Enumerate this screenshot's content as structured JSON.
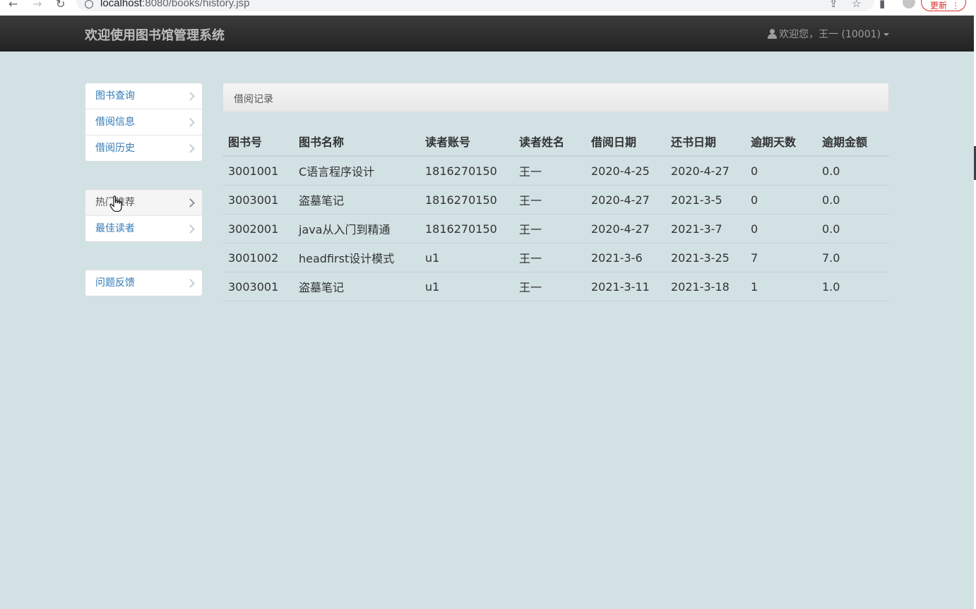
{
  "browser": {
    "url_host": "localhost",
    "url_rest": ":8080/books/history.jsp",
    "update_label": "更新",
    "update_more": "⋮"
  },
  "navbar": {
    "brand": "欢迎使用图书馆管理系统",
    "user_label": "欢迎您，王一 (10001)"
  },
  "sidebar": {
    "groups": [
      {
        "items": [
          {
            "label": "图书查询"
          },
          {
            "label": "借阅信息"
          },
          {
            "label": "借阅历史"
          }
        ]
      },
      {
        "items": [
          {
            "label": "热门推荐"
          },
          {
            "label": "最佳读者"
          }
        ]
      },
      {
        "items": [
          {
            "label": "问题反馈"
          }
        ]
      }
    ]
  },
  "content": {
    "heading": "借阅记录",
    "columns": [
      "图书号",
      "图书名称",
      "读者账号",
      "读者姓名",
      "借阅日期",
      "还书日期",
      "逾期天数",
      "逾期金额"
    ],
    "rows": [
      [
        "3001001",
        "C语言程序设计",
        "1816270150",
        "王一",
        "2020-4-25",
        "2020-4-27",
        "0",
        "0.0"
      ],
      [
        "3003001",
        "盗墓笔记",
        "1816270150",
        "王一",
        "2020-4-27",
        "2021-3-5",
        "0",
        "0.0"
      ],
      [
        "3002001",
        "java从入门到精通",
        "1816270150",
        "王一",
        "2020-4-27",
        "2021-3-7",
        "0",
        "0.0"
      ],
      [
        "3001002",
        "headfirst设计模式",
        "u1",
        "王一",
        "2021-3-6",
        "2021-3-25",
        "7",
        "7.0"
      ],
      [
        "3003001",
        "盗墓笔记",
        "u1",
        "王一",
        "2021-3-11",
        "2021-3-18",
        "1",
        "1.0"
      ]
    ]
  }
}
